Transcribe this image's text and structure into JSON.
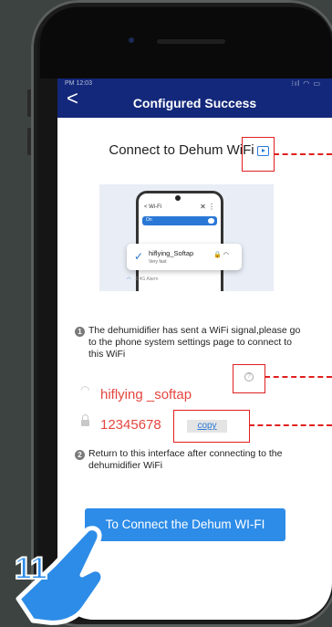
{
  "status_bar": {
    "time": "PM 12:03",
    "icons": "⁝ıl ◠ ▭"
  },
  "header": {
    "title": "Configured Success",
    "back_glyph": "<"
  },
  "main": {
    "heading": "Connect to Dehum WiFi",
    "illustration": {
      "screen_title": "< Wi-Fi",
      "close_glyph": "✕ ⋮",
      "toggle_label": "On",
      "network_name": "hiflying_Softap",
      "network_status": "Very fast",
      "icons": "🔒 ◠",
      "other_network": "2.4G Alarm"
    },
    "step1": {
      "number": "1",
      "text": "The dehumidifier has sent a WiFi signal,please go to the phone system settings page to connect to this WiFi"
    },
    "help_glyph": "?",
    "ssid": "hiflying _softap",
    "password": "12345678",
    "copy_label": "copy",
    "step2": {
      "number": "2",
      "text": "Return to this interface after connecting to the dehumidifier WiFi"
    },
    "connect_button": "To Connect the Dehum WI-FI"
  },
  "overlay": {
    "step_number": "11"
  },
  "colors": {
    "header": "#13287a",
    "button": "#2d8ce8",
    "highlight": "#e5463f",
    "annotation": "#e02020",
    "link": "#2a78d6"
  }
}
